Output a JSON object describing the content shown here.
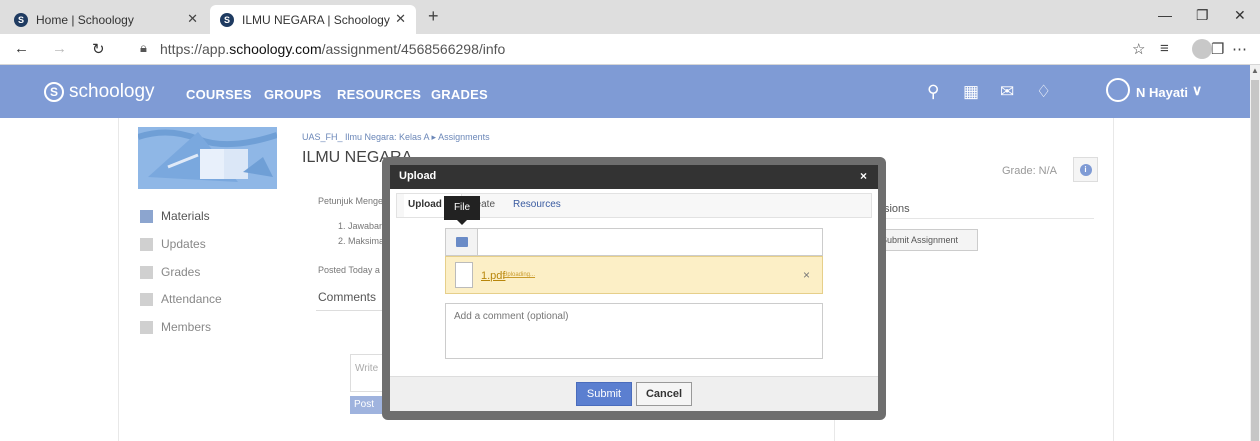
{
  "browser": {
    "tabs": [
      {
        "label": "Home | Schoology",
        "favicon": "S",
        "active": false
      },
      {
        "label": "ILMU NEGARA | Schoology",
        "favicon": "S",
        "active": true
      }
    ],
    "new_tab_glyph": "+",
    "url_prefix": "https://app.",
    "url_host": "schoology.com",
    "url_path": "/assignment/4568566298/info",
    "icons": [
      "back-icon",
      "forward-icon",
      "refresh-icon",
      "lock-icon",
      "favorite-star-icon",
      "favorites-bar-icon",
      "collections-icon",
      "profile-icon",
      "more-icon",
      "minimize-icon",
      "maximize-icon",
      "close-icon"
    ]
  },
  "header": {
    "logo_text": "schoology",
    "logo_mark": "S",
    "nav": [
      "COURSES",
      "GROUPS",
      "RESOURCES",
      "GRADES"
    ],
    "user_name": "N Hayati",
    "icons": [
      "search-icon",
      "calendar-icon",
      "messages-icon",
      "notifications-icon",
      "user-avatar",
      "chevron-down-icon"
    ],
    "color": "#7f9bd5"
  },
  "sidebar": {
    "items": [
      {
        "label": "Materials",
        "active": true
      },
      {
        "label": "Updates",
        "active": false
      },
      {
        "label": "Grades",
        "active": false
      },
      {
        "label": "Attendance",
        "active": false
      },
      {
        "label": "Members",
        "active": false
      }
    ]
  },
  "main": {
    "breadcrumb": "UAS_FH_ Ilmu Negara: Kelas A ▸ Assignments",
    "title": "ILMU NEGARA",
    "instructions": "Petunjuk Menge",
    "lines": [
      "1. Jawaban",
      "2. Maksima"
    ],
    "posted": "Posted Today a",
    "comments_heading": "Comments",
    "write_placeholder": "Write",
    "post_label": "Post",
    "grade_label": "Grade: N/A",
    "submissions_heading": "issions",
    "submit_assignment_label": "Submit Assignment"
  },
  "modal": {
    "title": "Upload",
    "close_glyph": "×",
    "tabs": [
      "Upload",
      "Create",
      "Resources"
    ],
    "tooltip": "File",
    "file": {
      "name": "1.pdf",
      "status": "Uploading..."
    },
    "remove_glyph": "×",
    "comment_placeholder": "Add a comment (optional)",
    "submit_label": "Submit",
    "cancel_label": "Cancel"
  }
}
